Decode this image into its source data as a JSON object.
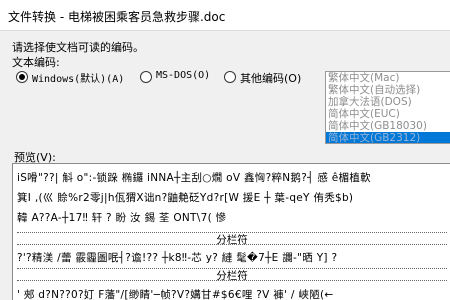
{
  "window": {
    "title": "文件转换 - 电梯被困乘客员急救步骤.doc"
  },
  "instructions": "请选择使文档可读的编码。",
  "encoding_label": "文本编码:",
  "radios": {
    "windows": "Windows(默认)(A)",
    "msdos": "MS-DOS(O)",
    "other": "其他编码(O)"
  },
  "encoding_list": [
    "繁体中文(Mac)",
    "繁体中文(自动选择)",
    "加拿大法语(DOS)",
    "简体中文(EUC)",
    "简体中文(GB18030)",
    "简体中文(GB2312)"
  ],
  "preview": {
    "label": "预览(V):",
    "lines": [
      "iS嗗\"??|  斛 o\":-锁跺 椭鑼 iNNA┼主刮○燗 oV 鑫恟?粹N鹅?┤  感 ê楣植軟",
      "箕I  ,(巛  賒%r2零j|h佤猬X诎n?鼬艴砭Yd?r[W 援E ┼ 葉-qeY 侑秃$b)",
      "韓     A??A-┼17‼    轩     ?    盼     汝     錫     荃     ONT\\7(    慘",
      "?'?精渼  /蕾 霰霾圖呡┤?谵!??  ┼k8‼-芯 y?  縺   髦�7┼E   讕-\"晒 Y]   ?",
      "' 郟 d?N??0?奵 F藩\"/[缈睛'─帧?V?媾甘#$6€哩 ?V 褲'  /     峽陋(←"
    ],
    "separator_label": "分栏符"
  }
}
